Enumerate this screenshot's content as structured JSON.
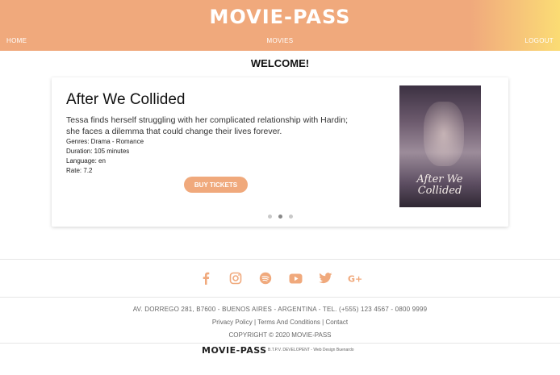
{
  "header": {
    "logo": "MOVIE-PASS",
    "nav": {
      "home": "HOME",
      "movies": "MOVIES",
      "logout": "LOGOUT"
    },
    "colors": {
      "accent": "#f0a97c"
    }
  },
  "welcome": "WELCOME!",
  "carousel": {
    "movie": {
      "title": "After We Collided",
      "description": "Tessa finds herself struggling with her complicated relationship with Hardin; she faces a dilemma that could change their lives forever.",
      "genres": "Genres: Drama - Romance",
      "duration": "Duration: 105 minutes",
      "language": "Language: en",
      "rate": "Rate: 7.2",
      "poster_text": "After We Collided"
    },
    "buy_label": "BUY TICKETS",
    "slides": 3,
    "active_slide": 2
  },
  "footer": {
    "social": [
      "facebook-icon",
      "instagram-icon",
      "spotify-icon",
      "youtube-icon",
      "twitter-icon",
      "google-plus-icon"
    ],
    "address": "AV. DORREGO 281, B7600 - BUENOS AIRES - ARGENTINA - TEL. (+555) 123 4567 - 0800 9999",
    "links": {
      "privacy": "Privacy Policy",
      "terms": "Terms And Conditions",
      "contact": "Contact",
      "sep": "|"
    },
    "copyright": "COPYRIGHT © 2020 MOVIE-PASS",
    "logo": "MOVIE-PASS",
    "credits": "B.T.P.V. DEVELOPENT - Web Design Buenardo"
  }
}
